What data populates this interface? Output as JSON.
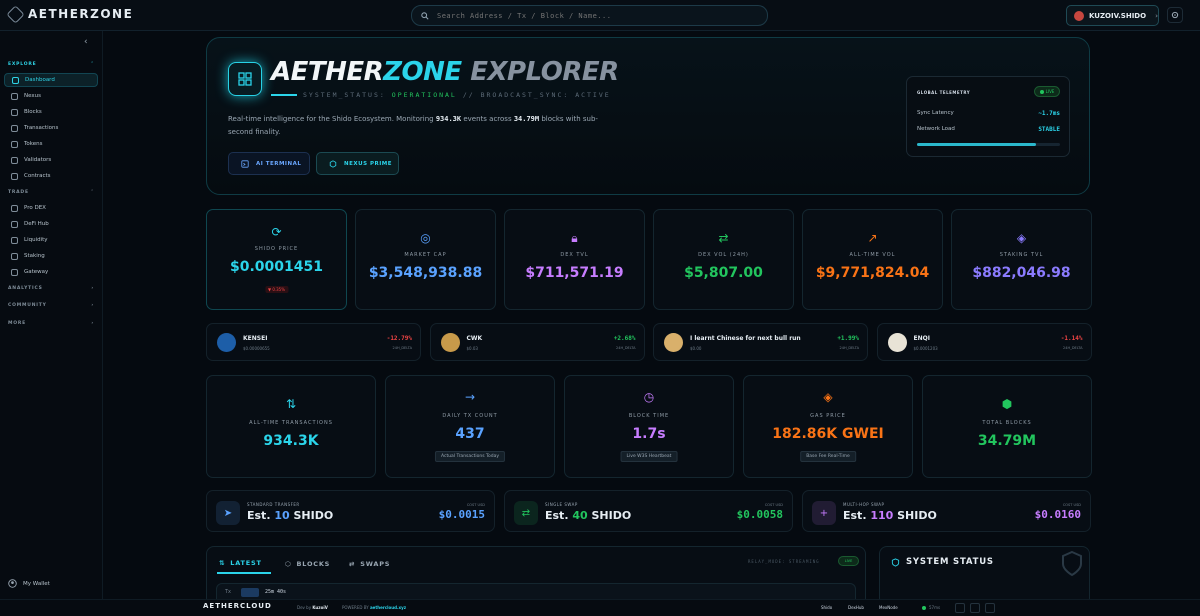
{
  "brand": {
    "name": "AETHERZONE"
  },
  "search": {
    "placeholder": "Search Address / Tx / Block / Name..."
  },
  "user": {
    "name": "KUZOIV.SHIDO"
  },
  "sidebar": {
    "explore_label": "EXPLORE",
    "explore_items": [
      {
        "label": "Dashboard",
        "icon": "grid-icon",
        "active": true
      },
      {
        "label": "Nexus",
        "icon": "hexagon-icon"
      },
      {
        "label": "Blocks",
        "icon": "cube-icon"
      },
      {
        "label": "Transactions",
        "icon": "arrows-icon"
      },
      {
        "label": "Tokens",
        "icon": "coin-icon"
      },
      {
        "label": "Validators",
        "icon": "shield-icon"
      },
      {
        "label": "Contracts",
        "icon": "document-icon"
      }
    ],
    "trade_label": "TRADE",
    "trade_items": [
      {
        "label": "Pro DEX",
        "icon": "chart-icon"
      },
      {
        "label": "DeFi Hub",
        "icon": "hub-icon"
      },
      {
        "label": "Liquidity",
        "icon": "drop-icon"
      },
      {
        "label": "Staking",
        "icon": "layers-icon"
      },
      {
        "label": "Gateway",
        "icon": "gateway-icon"
      }
    ],
    "analytics_label": "ANALYTICS",
    "community_label": "COMMUNITY",
    "more_label": "MORE",
    "wallet_label": "My Wallet"
  },
  "hero": {
    "title_a": "AETHER",
    "title_b": "ZONE",
    "title_c": " EXPLORER",
    "status_prefix": "SYSTEM_STATUS:",
    "status_value": "OPERATIONAL",
    "status_suffix": "// BROADCAST_SYNC: ACTIVE",
    "desc_1": "Real-time intelligence for the Shido Ecosystem. Monitoring",
    "desc_events": "934.3K",
    "desc_2": "events across",
    "desc_blocks": "34.79M",
    "desc_3": "blocks with sub-second finality.",
    "btn_ai": "AI TERMINAL",
    "btn_nexus": "NEXUS PRIME"
  },
  "telemetry": {
    "title": "GLOBAL TELEMETRY",
    "live": "LIVE",
    "sync_label": "Sync Latency",
    "sync_value": "~1.7ms",
    "load_label": "Network Load",
    "load_value": "STABLE",
    "load_fraction": 0.83
  },
  "stats": [
    {
      "label": "SHIDO PRICE",
      "value": "$0.0001451",
      "change": "▼ 0.35%",
      "color": "#2bd4ea",
      "icon": "refresh-icon"
    },
    {
      "label": "MARKET CAP",
      "value": "$3,548,938.88",
      "color": "#5aa2ff",
      "icon": "globe-icon"
    },
    {
      "label": "DEX TVL",
      "value": "$711,571.19",
      "color": "#c77dff",
      "icon": "lock-icon"
    },
    {
      "label": "DEX VOL (24H)",
      "value": "$5,807.00",
      "color": "#22c55e",
      "icon": "swap-icon"
    },
    {
      "label": "ALL-TIME VOL",
      "value": "$9,771,824.04",
      "color": "#f97316",
      "icon": "trend-icon"
    },
    {
      "label": "STAKING TVL",
      "value": "$882,046.98",
      "color": "#8b7bff",
      "icon": "layers-icon"
    }
  ],
  "tokens": [
    {
      "name": "KENSEI",
      "price": "$0.00000655",
      "change": "-12.79%",
      "delta": "24H_DELTA",
      "color": "#ef4444",
      "avatar": "#1d5ea8"
    },
    {
      "name": "CWK",
      "price": "$0.03",
      "change": "+2.68%",
      "delta": "24H_DELTA",
      "color": "#22c55e",
      "avatar": "#c89a4a"
    },
    {
      "name": "I learnt Chinese for next bull run",
      "price": "$0.00",
      "change": "+1.99%",
      "delta": "24H_DELTA",
      "color": "#22c55e",
      "avatar": "#d9b06b"
    },
    {
      "name": "ENQI",
      "price": "$0.0001203",
      "change": "-1.14%",
      "delta": "24H_DELTA",
      "color": "#ef4444",
      "avatar": "#e8e3d6"
    }
  ],
  "metrics": [
    {
      "label": "ALL-TIME TRANSACTIONS",
      "value": "934.3K",
      "color": "#2bd4ea",
      "icon": "arrows-icon"
    },
    {
      "label": "DAILY TX COUNT",
      "value": "437",
      "sub": "Actual Transactions Today",
      "color": "#5aa2ff",
      "icon": "arrow-right-icon"
    },
    {
      "label": "BLOCK TIME",
      "value": "1.7s",
      "sub": "Live W3S Heartbeat",
      "color": "#c77dff",
      "icon": "clock-icon"
    },
    {
      "label": "GAS PRICE",
      "value": "182.86K GWEI",
      "sub": "Base Fee Real-Time",
      "color": "#f97316",
      "icon": "flame-icon"
    },
    {
      "label": "TOTAL BLOCKS",
      "value": "34.79M",
      "color": "#22c55e",
      "icon": "cube-icon"
    }
  ],
  "tx_types": [
    {
      "label": "STANDARD TRANSFER",
      "value_prefix": "Est. ",
      "value_num": "10",
      "value_unit": " SHIDO",
      "unit_label": "COST USD",
      "usd": "$0.0015",
      "color": "#5aa2ff",
      "icon": "send-icon"
    },
    {
      "label": "SINGLE SWAP",
      "value_prefix": "Est. ",
      "value_num": "40",
      "value_unit": " SHIDO",
      "unit_label": "COST USD",
      "usd": "$0.0058",
      "color": "#22c55e",
      "icon": "swap-icon"
    },
    {
      "label": "MULTI-HOP SWAP",
      "value_prefix": "Est. ",
      "value_num": "110",
      "value_unit": " SHIDO",
      "unit_label": "COST USD",
      "usd": "$0.0160",
      "color": "#c77dff",
      "icon": "plus-icon"
    }
  ],
  "feed": {
    "tabs": [
      "LATEST",
      "BLOCKS",
      "SWAPS"
    ],
    "relay": "RELAY_MODE: STREAMING",
    "live": "LIVE",
    "row_id": "25m 40s"
  },
  "system_status": {
    "title": "SYSTEM STATUS"
  },
  "footer": {
    "brand": "AETHERCLOUD",
    "dev_by": "Dev by",
    "dev_name": "KuzoiV",
    "powered": "POWERED BY",
    "powered_name": "aethercloud.xyz",
    "links": [
      "Shido",
      "DexHub",
      "MexNode"
    ],
    "latency": "57ms"
  }
}
